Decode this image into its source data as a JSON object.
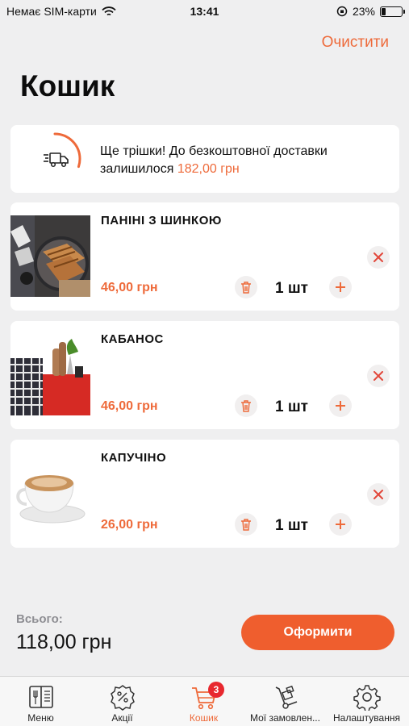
{
  "status_bar": {
    "carrier": "Немає SIM-карти",
    "time": "13:41",
    "battery": "23%",
    "battery_level": 0.23
  },
  "header": {
    "clear_label": "Очистити",
    "title": "Кошик"
  },
  "delivery": {
    "message": "Ще трішки! До безкоштовної доставки залишилося",
    "amount": "182,00 грн",
    "progress": 0.3
  },
  "items": [
    {
      "name": "ПАНІНІ З ШИНКОЮ",
      "price": "46,00 грн",
      "qty": "1 шт"
    },
    {
      "name": "КАБАНОС",
      "price": "46,00 грн",
      "qty": "1 шт"
    },
    {
      "name": "КАПУЧІНО",
      "price": "26,00 грн",
      "qty": "1 шт"
    }
  ],
  "total": {
    "label": "Всього:",
    "value": "118,00 грн"
  },
  "checkout_label": "Оформити",
  "tabs": [
    {
      "label": "Меню",
      "icon": "menu-book-icon"
    },
    {
      "label": "Акції",
      "icon": "discount-badge-icon"
    },
    {
      "label": "Кошик",
      "icon": "cart-icon",
      "badge": "3",
      "active": true
    },
    {
      "label": "Мої замовлен...",
      "icon": "hand-truck-icon"
    },
    {
      "label": "Налаштування",
      "icon": "gear-icon"
    }
  ],
  "colors": {
    "accent": "#ee6a3a",
    "button": "#ef5e2e",
    "badge": "#e8282f",
    "background": "#efeff0"
  }
}
